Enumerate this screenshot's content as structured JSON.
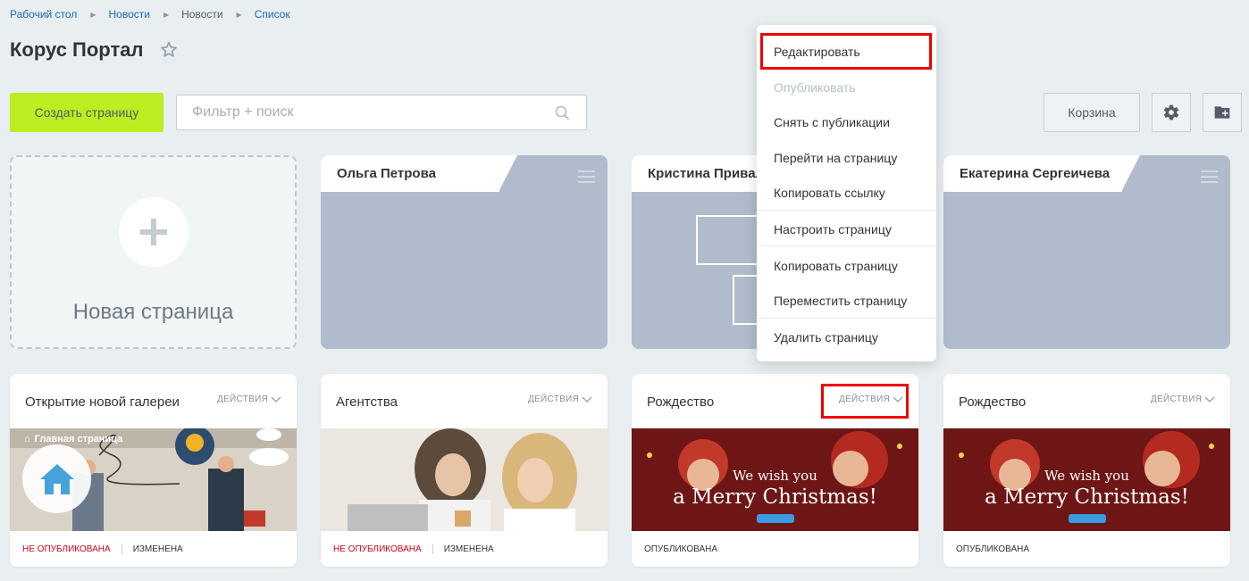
{
  "breadcrumb": [
    "Рабочий стол",
    "Новости",
    "Новости",
    "Список"
  ],
  "page_title": "Корус Портал",
  "toolbar": {
    "create_label": "Создать страницу",
    "search_placeholder": "Фильтр + поиск",
    "trash_label": "Корзина"
  },
  "new_page_label": "Новая страница",
  "folders": [
    {
      "name": "Ольга Петрова"
    },
    {
      "name": "Кристина Приваль"
    },
    {
      "name": "Екатерина Сергеичева"
    }
  ],
  "cards": [
    {
      "title": "Открытие новой галереи",
      "actions": "ДЕЙСТВИЯ",
      "status": "НЕ ОПУБЛИКОВАНА",
      "status2": "ИЗМЕНЕНА",
      "overlay": "Главная страница"
    },
    {
      "title": "Агентства",
      "actions": "ДЕЙСТВИЯ",
      "status": "НЕ ОПУБЛИКОВАНА",
      "status2": "ИЗМЕНЕНА"
    },
    {
      "title": "Рождество",
      "actions": "ДЕЙСТВИЯ",
      "status": "ОПУБЛИКОВАНА",
      "banner1": "We wish you",
      "banner2": "a Merry Christmas!"
    },
    {
      "title": "Рождество",
      "actions": "ДЕЙСТВИЯ",
      "status": "ОПУБЛИКОВАНА",
      "banner1": "We wish you",
      "banner2": "a Merry Christmas!"
    }
  ],
  "context_menu": [
    {
      "label": "Редактировать",
      "disabled": false
    },
    {
      "label": "Опубликовать",
      "disabled": true
    },
    {
      "label": "Снять с публикации",
      "disabled": false
    },
    {
      "label": "Перейти на страницу",
      "disabled": false
    },
    {
      "label": "Копировать ссылку",
      "disabled": false
    },
    {
      "label": "Настроить страницу",
      "disabled": false
    },
    {
      "label": "Копировать страницу",
      "disabled": false
    },
    {
      "label": "Переместить страницу",
      "disabled": false
    },
    {
      "label": "Удалить страницу",
      "disabled": false
    }
  ],
  "colors": {
    "accent": "#bbed21",
    "folder": "#b0bccb",
    "highlight": "#e00000",
    "unpublished": "#d0021b"
  },
  "icons": [
    "star-icon",
    "search-icon",
    "gear-icon",
    "folder-add-icon",
    "plus-icon",
    "menu-icon",
    "chevron-down-icon",
    "home-icon"
  ]
}
